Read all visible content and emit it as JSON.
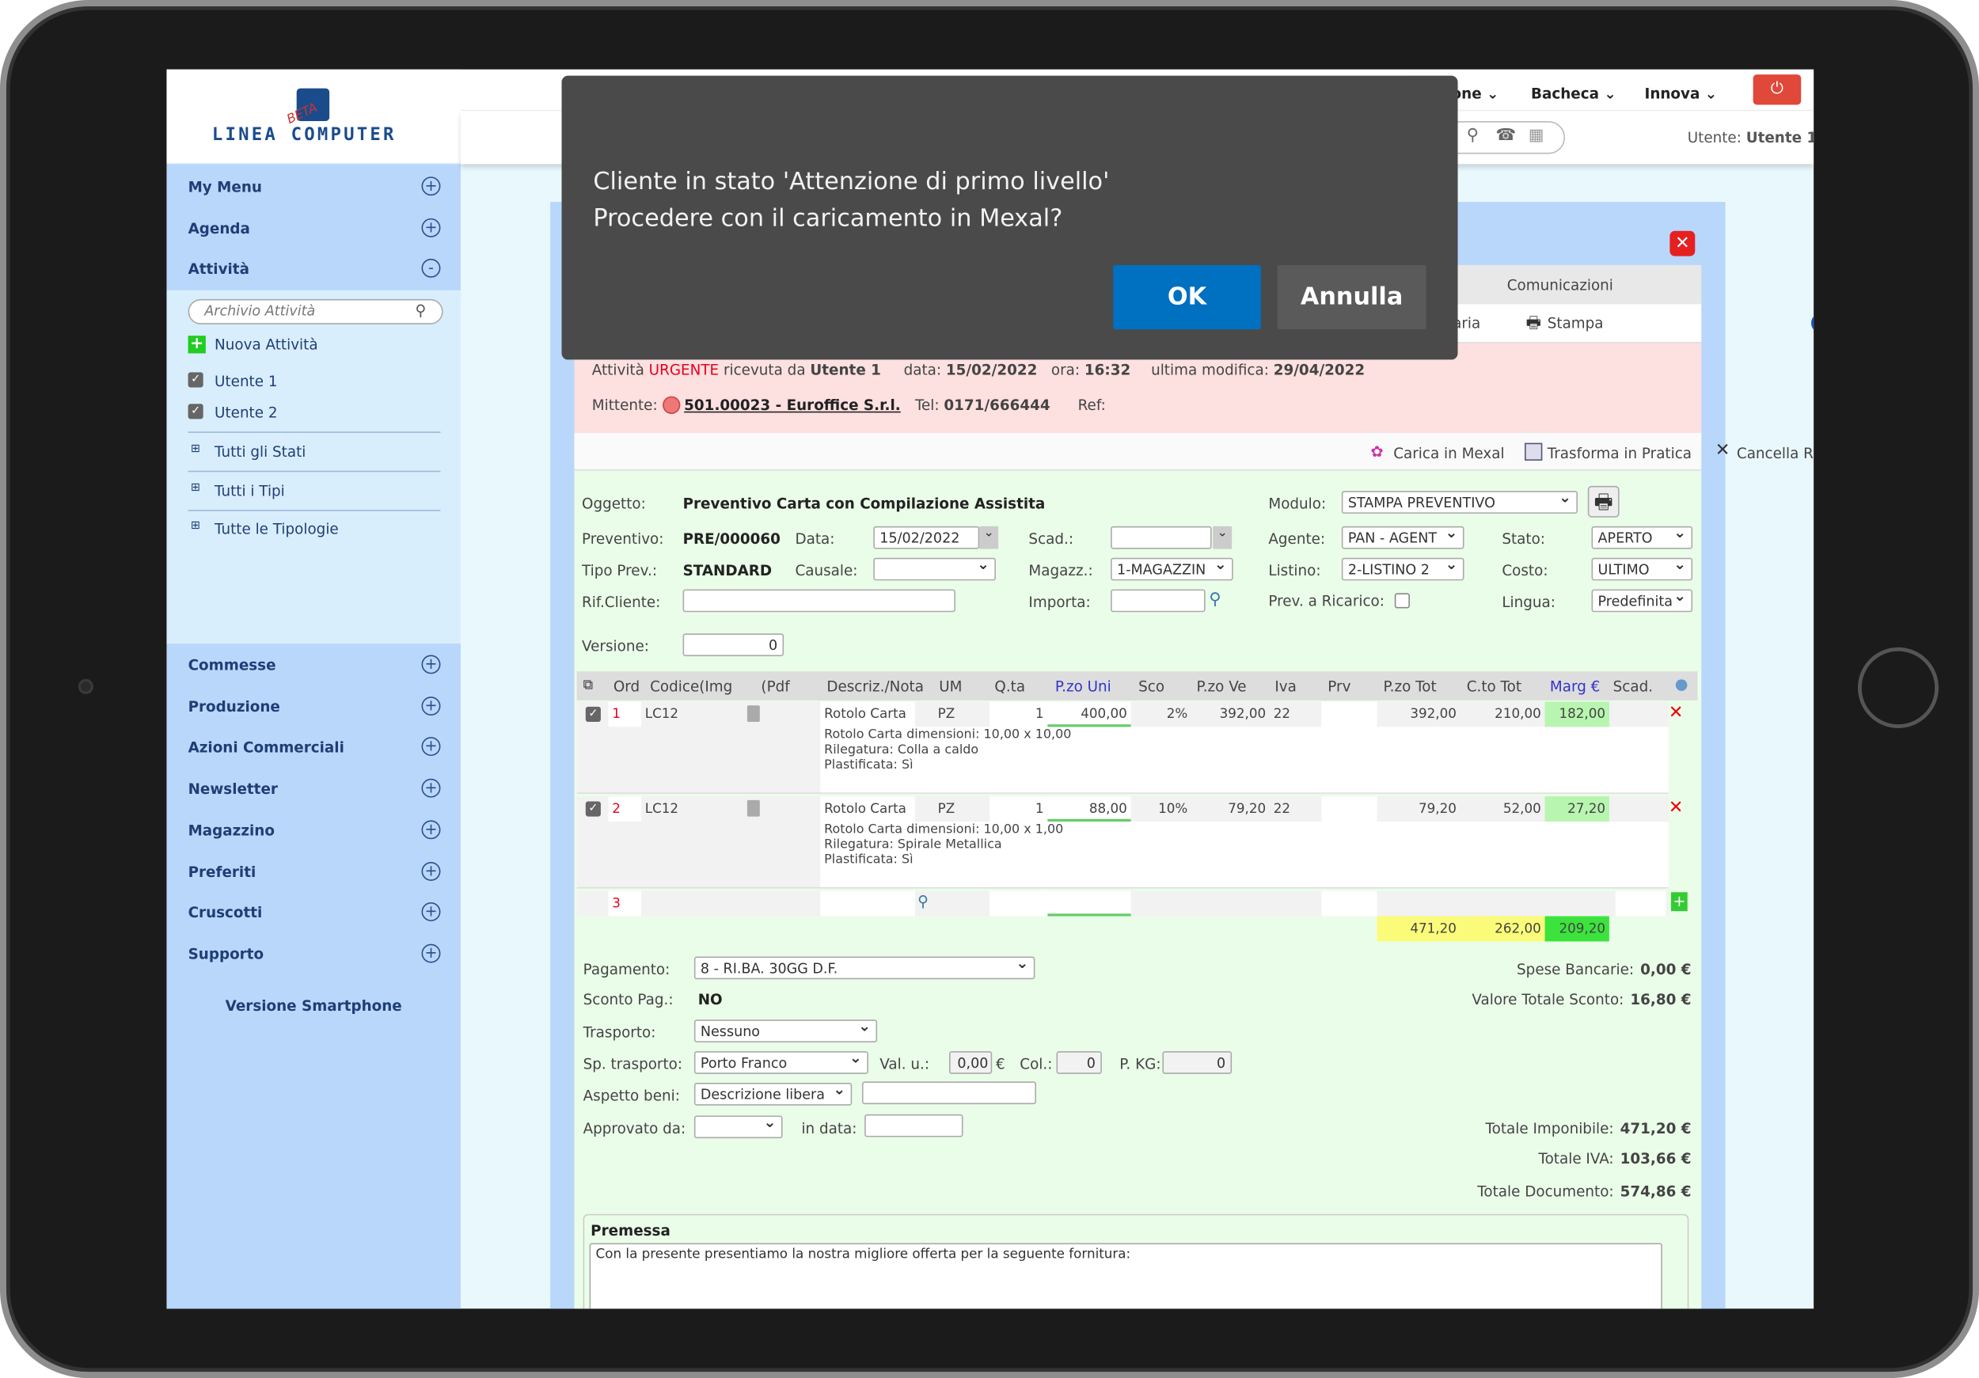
{
  "logo": {
    "text": "LINEA COMPUTER",
    "badge": "BETA"
  },
  "sidebar": {
    "top_items": [
      {
        "label": "My Menu",
        "toggle": "+"
      },
      {
        "label": "Agenda",
        "toggle": "+"
      },
      {
        "label": "Attività",
        "toggle": "-"
      }
    ],
    "search_placeholder": "Archivio Attività",
    "new_activity": "Nuova Attività",
    "users": [
      {
        "label": "Utente 1",
        "checked": true
      },
      {
        "label": "Utente 2",
        "checked": true
      }
    ],
    "filters": [
      "Tutti gli Stati",
      "Tutti i Tipi",
      "Tutte le Tipologie"
    ],
    "bottom_items": [
      "Commesse",
      "Produzione",
      "Azioni Commerciali",
      "Newsletter",
      "Magazzino",
      "Preferiti",
      "Cruscotti",
      "Supporto"
    ],
    "smartphone": "Versione Smartphone"
  },
  "topbar": {
    "menus": [
      "one",
      "Bacheca",
      "Innova"
    ],
    "user_label": "Utente:",
    "user_name": "Utente 1"
  },
  "colors": {
    "accent": "#0070c0",
    "sidebar": "#b9d7fb",
    "urgent": "#e8001c",
    "form_bg": "#eafde8",
    "info_bg": "#fde0e0"
  },
  "dialog": {
    "line1": "Cliente in stato 'Attenzione di primo livello'",
    "line2": "Procedere con il caricamento in Mexal?",
    "ok": "OK",
    "cancel": "Annulla"
  },
  "tabs": {
    "comunicazioni": "Comunicazioni",
    "partial": "aria",
    "stampa": "Stampa",
    "help": "?"
  },
  "info": {
    "att": "Attività",
    "urgent": "URGENTE",
    "received": "ricevuta da",
    "from_user": "Utente 1",
    "data_label": "data:",
    "data": "15/02/2022",
    "ora_label": "ora:",
    "ora": "16:32",
    "mod_label": "ultima modifica:",
    "mod": "29/04/2022",
    "mitt_label": "Mittente:",
    "mittente": "501.00023 - Euroffice S.r.l.",
    "tel_label": "Tel:",
    "tel": "0171/666444",
    "ref_label": "Ref:"
  },
  "actions": [
    "Carica in Mexal",
    "Trasforma in Pratica",
    "Cancella Righe"
  ],
  "form": {
    "oggetto_l": "Oggetto:",
    "oggetto": "Preventivo Carta con Compilazione Assistita",
    "modulo_l": "Modulo:",
    "modulo": "STAMPA PREVENTIVO",
    "prev_l": "Preventivo:",
    "prev": "PRE/000060",
    "data_l": "Data:",
    "data": "15/02/2022",
    "scad_l": "Scad.:",
    "scad": "",
    "agente_l": "Agente:",
    "agente": "PAN - AGENT",
    "stato_l": "Stato:",
    "stato": "APERTO",
    "tipo_l": "Tipo Prev.:",
    "tipo": "STANDARD",
    "causale_l": "Causale:",
    "causale": "",
    "magazz_l": "Magazz.:",
    "magazz": "1-MAGAZZIN",
    "listino_l": "Listino:",
    "listino": "2-LISTINO 2",
    "costo_l": "Costo:",
    "costo": "ULTIMO",
    "rif_l": "Rif.Cliente:",
    "rif": "",
    "importa_l": "Importa:",
    "importa": "",
    "ricarico_l": "Prev. a Ricarico:",
    "lingua_l": "Lingua:",
    "lingua": "Predefinita",
    "versione_l": "Versione:",
    "versione": "0"
  },
  "table": {
    "headers": [
      "Ord",
      "Codice(Img",
      "(Pdf",
      "Descriz./Nota",
      "UM",
      "Q.ta",
      "P.zo Uni",
      "Sco",
      "P.zo Ve",
      "Iva",
      "Prv",
      "P.zo Tot",
      "C.to Tot",
      "Marg €",
      "Scad."
    ],
    "rows": [
      {
        "ord": "1",
        "codice": "LC12",
        "descr": "Rotolo Carta",
        "um": "PZ",
        "qta": "1",
        "pzuni": "400,00",
        "sco": "2%",
        "pzve": "392,00",
        "iva": "22",
        "prv": "",
        "pztot": "392,00",
        "ctot": "210,00",
        "marg": "182,00",
        "note": [
          "Rotolo Carta dimensioni: 10,00 x 10,00",
          "Rilegatura: Colla a caldo",
          "Plastificata: Sì"
        ]
      },
      {
        "ord": "2",
        "codice": "LC12",
        "descr": "Rotolo Carta",
        "um": "PZ",
        "qta": "1",
        "pzuni": "88,00",
        "sco": "10%",
        "pzve": "79,20",
        "iva": "22",
        "prv": "",
        "pztot": "79,20",
        "ctot": "52,00",
        "marg": "27,20",
        "note": [
          "Rotolo Carta dimensioni: 10,00 x 1,00",
          "Rilegatura:  Spirale Metallica",
          "Plastificata: Sì"
        ]
      }
    ],
    "new_row_ord": "3",
    "totals": {
      "pztot": "471,20",
      "ctot": "262,00",
      "marg": "209,20"
    }
  },
  "footer": {
    "pag_l": "Pagamento:",
    "pag": "8 - RI.BA. 30GG D.F.",
    "sconto_l": "Sconto Pag.:",
    "sconto": "NO",
    "trasp_l": "Trasporto:",
    "trasp": "Nessuno",
    "sptr_l": "Sp. trasporto:",
    "sptr": "Porto Franco",
    "valu_l": "Val. u.:",
    "valu": "0,00",
    "euro": "€",
    "col_l": "Col.:",
    "col": "0",
    "pkg_l": "P. KG:",
    "pkg": "0",
    "asp_l": "Aspetto beni:",
    "asp": "Descrizione libera",
    "appr_l": "Approvato da:",
    "indata_l": "in data:",
    "spese_l": "Spese Bancarie:",
    "spese": "0,00 €",
    "vts_l": "Valore Totale Sconto:",
    "vts": "16,80 €",
    "imp_l": "Totale Imponibile:",
    "imp": "471,20 €",
    "iva_l": "Totale IVA:",
    "iva": "103,66 €",
    "doc_l": "Totale Documento:",
    "doc": "574,86 €",
    "premessa_l": "Premessa",
    "premessa": "Con la presente presentiamo la nostra migliore offerta per la seguente fornitura:"
  }
}
